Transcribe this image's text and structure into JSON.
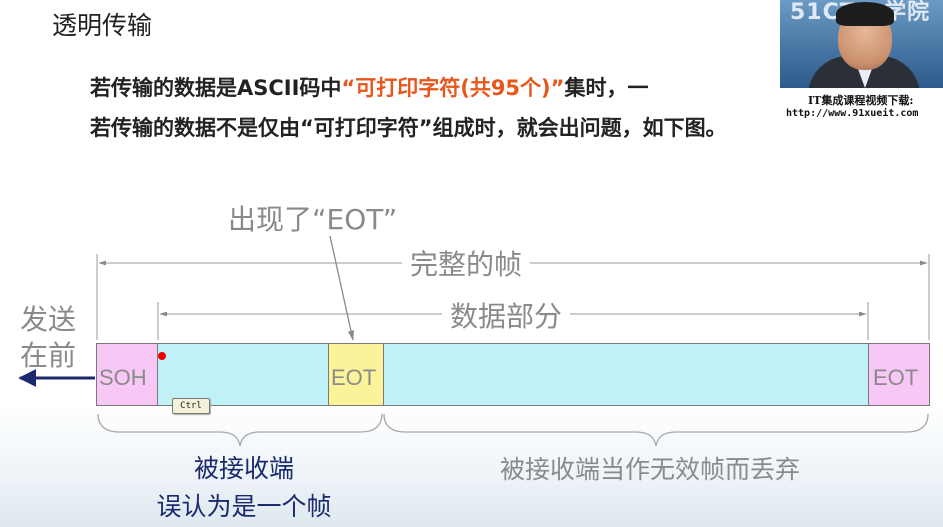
{
  "slide": {
    "title": "透明传输",
    "line1_a": "若传输的数据是ASCII码中",
    "line1_hl": "“可打印字符(共95个)”",
    "line1_b": "集时，一",
    "line2": "若传输的数据不是仅由“可打印字符”组成时，就会出问题，如下图。"
  },
  "video": {
    "logo": "51CTO 学院",
    "caption": "IT集成课程视频下载:",
    "url": "http://www.91xueit.com"
  },
  "diagram": {
    "eot_appear": "出现了“EOT”",
    "full_frame": "完整的帧",
    "data_part": "数据部分",
    "send_first_1": "发送",
    "send_first_2": "在前",
    "soh": "SOH",
    "eot_mid": "EOT",
    "eot_end": "EOT",
    "ctrl_key": "Ctrl",
    "left_caption_1": "被接收端",
    "left_caption_2": "误认为是一个帧",
    "right_caption": "被接收端当作无效帧而丢弃"
  },
  "colors": {
    "soh_fill": "#f7c8f5",
    "data_fill": "#bff1f7",
    "eot_fill": "#fbf39a",
    "highlight": "#e8561b",
    "arrow_blue": "#1a2a6c"
  }
}
